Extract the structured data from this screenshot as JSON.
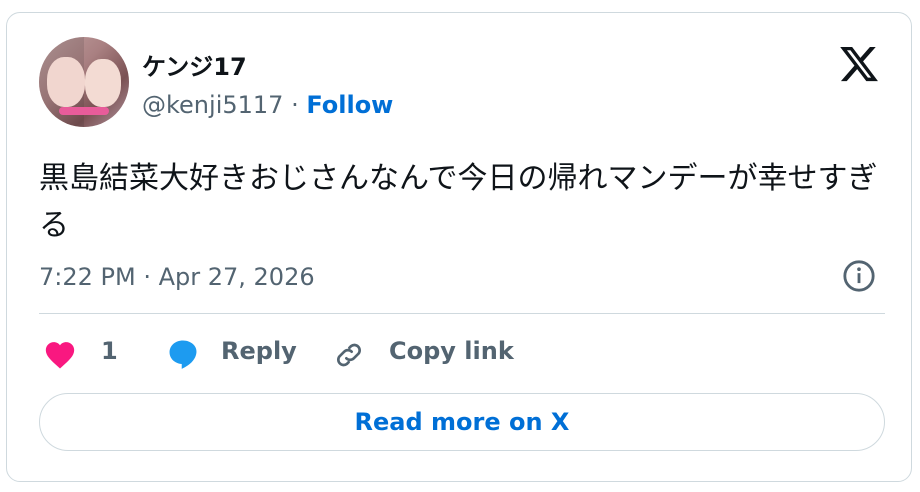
{
  "author": {
    "display_name": "ケンジ17",
    "handle": "@kenji5117",
    "separator": " · ",
    "follow_label": "Follow"
  },
  "logo_icon": "x-logo-icon",
  "tweet": {
    "text": "黒島結菜大好きおじさんなんで今日の帰れマンデーが幸せすぎる",
    "timestamp": "7:22 PM · Apr 27, 2026"
  },
  "actions": {
    "like_count": "1",
    "reply_label": "Reply",
    "copy_link_label": "Copy link"
  },
  "read_more_label": "Read more on X",
  "colors": {
    "accent": "#006fd6",
    "like": "#f91880",
    "reply": "#1d9bf0",
    "muted": "#536471",
    "border": "#cfd9de"
  }
}
